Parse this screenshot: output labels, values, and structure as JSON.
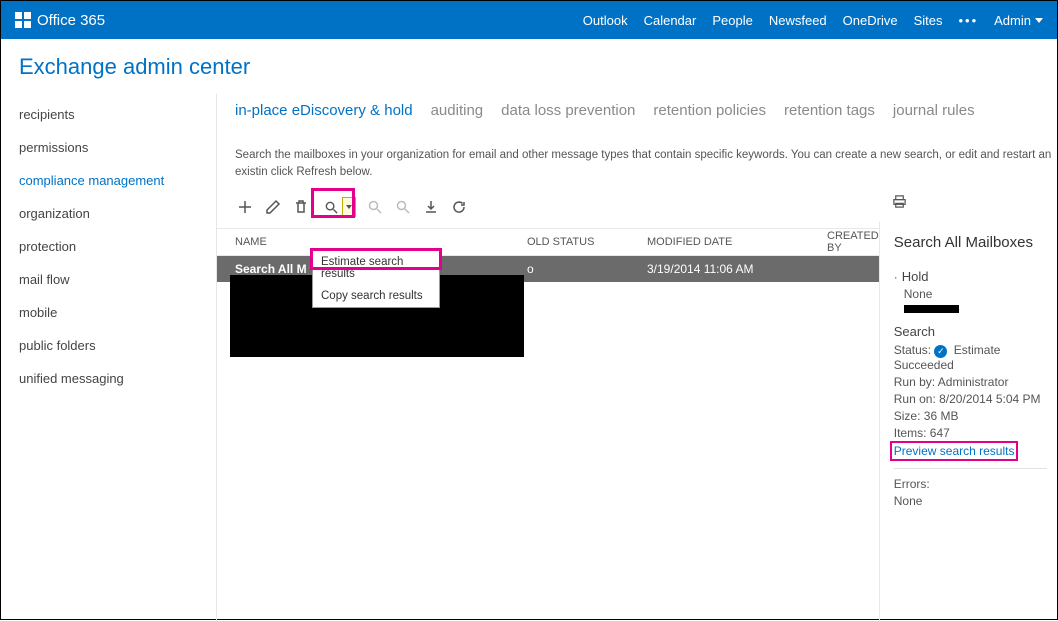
{
  "topbar": {
    "brand": "Office 365",
    "links": [
      "Outlook",
      "Calendar",
      "People",
      "Newsfeed",
      "OneDrive",
      "Sites"
    ],
    "ellipsis": "•••",
    "admin": "Admin"
  },
  "app_title": "Exchange admin center",
  "sidebar": {
    "items": [
      {
        "label": "recipients"
      },
      {
        "label": "permissions"
      },
      {
        "label": "compliance management",
        "active": true
      },
      {
        "label": "organization"
      },
      {
        "label": "protection"
      },
      {
        "label": "mail flow"
      },
      {
        "label": "mobile"
      },
      {
        "label": "public folders"
      },
      {
        "label": "unified messaging"
      }
    ]
  },
  "tabs": [
    {
      "label": "in-place eDiscovery & hold",
      "active": true
    },
    {
      "label": "auditing"
    },
    {
      "label": "data loss prevention"
    },
    {
      "label": "retention policies"
    },
    {
      "label": "retention tags"
    },
    {
      "label": "journal rules"
    }
  ],
  "description": "Search the mailboxes in your organization for email and other message types that contain specific keywords. You can create a new search, or edit and restart an existin click Refresh below.",
  "table": {
    "headers": {
      "name": "NAME",
      "hold": "OLD STATUS",
      "modified": "MODIFIED DATE",
      "created_by": "CREATED BY"
    },
    "row": {
      "name": "Search All M",
      "hold": "o",
      "modified": "3/19/2014 11:06 AM"
    }
  },
  "search_menu": {
    "estimate": "Estimate search results",
    "copy": "Copy search results"
  },
  "details": {
    "title": "Search All Mailboxes",
    "hold_label": "Hold",
    "hold_value": "None",
    "search_label": "Search",
    "status_label": "Status:",
    "status_value": "Estimate Succeeded",
    "runby_label": "Run by:",
    "runby_value": "Administrator",
    "runon_label": "Run on:",
    "runon_value": "8/20/2014 5:04 PM",
    "size_label": "Size:",
    "size_value": "36 MB",
    "items_label": "Items:",
    "items_value": "647",
    "preview_link": "Preview search results",
    "errors_label": "Errors:",
    "errors_value": "None"
  }
}
